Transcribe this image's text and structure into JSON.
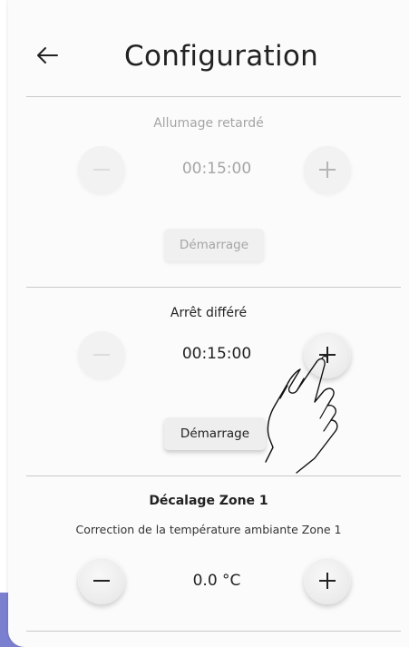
{
  "header": {
    "back_icon": "arrow-left-icon",
    "title": "Configuration"
  },
  "sections": [
    {
      "title": "Allumage retardé",
      "value": "00:15:00",
      "enabled": false,
      "minus_icon": "minus-icon",
      "plus_icon": "plus-icon",
      "button_label": "Démarrage"
    },
    {
      "title": "Arrêt différé",
      "value": "00:15:00",
      "enabled": true,
      "minus_icon": "minus-icon",
      "plus_icon": "plus-icon",
      "button_label": "Démarrage"
    },
    {
      "title": "Décalage Zone 1",
      "subtitle": "Correction de la température ambiante Zone 1",
      "value": "0.0 °C",
      "enabled": true,
      "minus_icon": "minus-icon",
      "plus_icon": "plus-icon"
    }
  ],
  "overlay": {
    "gesture_icon": "tap-hand-icon"
  },
  "colors": {
    "accent": "#7a7fd0",
    "disabled_text": "#a5a5a5",
    "divider": "#c9c9c9"
  }
}
